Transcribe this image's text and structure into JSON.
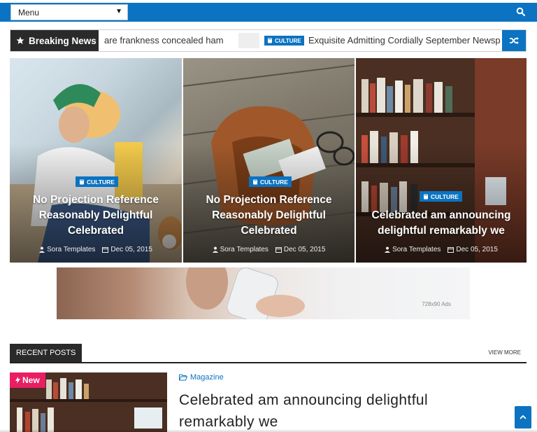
{
  "header": {
    "menu_label": "Menu",
    "menu_caret": "▼",
    "search_icon": "search-icon",
    "accent_color": "#0b73c1"
  },
  "breaking": {
    "label": "Breaking News",
    "items": [
      {
        "title": "are frankness concealed ham"
      },
      {
        "tag": "CULTURE",
        "title": "Exquisite Admitting Cordially September Newsp"
      }
    ],
    "shuffle_icon": "shuffle-icon"
  },
  "featured": [
    {
      "category": "CULTURE",
      "title": "No Projection Reference Reasonably Delightful Celebrated",
      "author": "Sora Templates",
      "date": "Dec 05, 2015"
    },
    {
      "category": "CULTURE",
      "title": "No Projection Reference Reasonably Delightful Celebrated",
      "author": "Sora Templates",
      "date": "Dec 05, 2015"
    },
    {
      "category": "CULTURE",
      "title": "Celebrated am announcing delightful remarkably we",
      "author": "Sora Templates",
      "date": "Dec 05, 2015"
    }
  ],
  "ad": {
    "label": "728x90 Ads"
  },
  "recent": {
    "heading": "RECENT POSTS",
    "view_more": "VIEW MORE",
    "post": {
      "badge": "New",
      "category": "Magazine",
      "title": "Celebrated am announcing delightful remarkably we"
    }
  }
}
